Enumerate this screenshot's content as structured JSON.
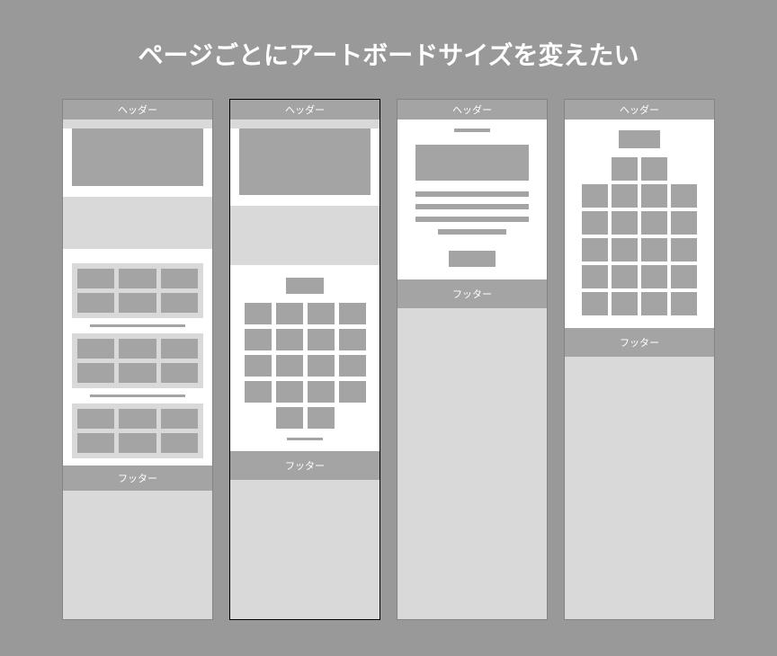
{
  "title": "ページごとにアートボードサイズを変えたい",
  "labels": {
    "header": "ヘッダー",
    "footer": "フッター"
  }
}
